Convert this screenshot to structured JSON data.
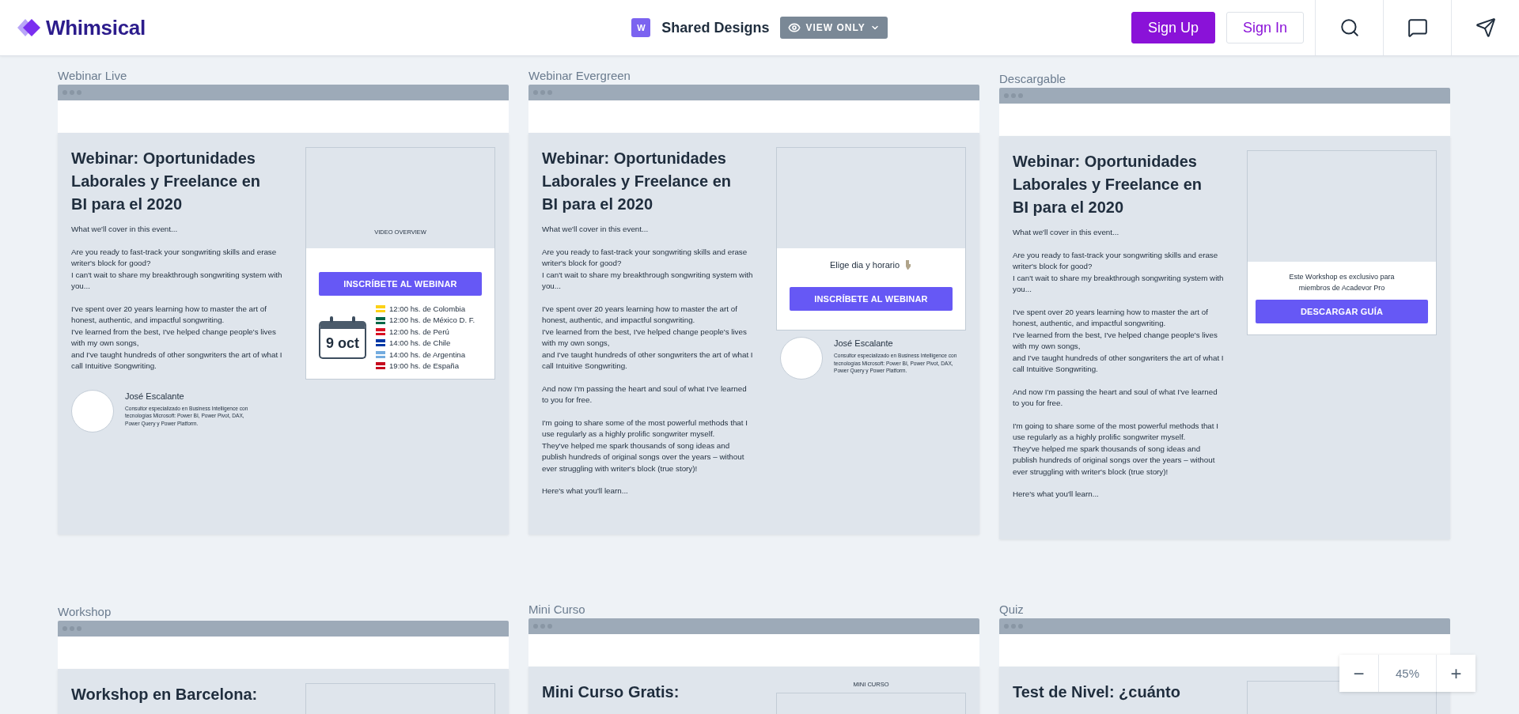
{
  "header": {
    "logo": "Whimsical",
    "board_badge": "W",
    "board_title": "Shared Designs",
    "access": "VIEW ONLY",
    "buttons": [
      {
        "label": "Sign Up",
        "kind": "primary"
      },
      {
        "label": "Sign In",
        "kind": "secondary"
      }
    ]
  },
  "frames": [
    {
      "label": "Webinar Live",
      "kind": "live",
      "title": "Webinar: Oportunidades\nLaborales y Freelance en\nBI para el 2020",
      "paragraphs": [
        "What we'll cover in this event...",
        "Are you ready to fast-track your songwriting skills and erase writer's block for good?\nI can't wait to share my breakthrough songwriting system with you...",
        "I've spent over 20 years learning how to master the art of honest, authentic, and impactful songwriting.\nI've learned from the best, I've helped change people's lives with my own songs,\nand I've taught hundreds of other songwriters the art of what I call Intuitive Songwriting."
      ],
      "card": {
        "media_caption": "VIDEO OVERVIEW",
        "button": "INSCRÍBETE AL WEBINAR",
        "date": "9 oct",
        "schedule": [
          {
            "text": "12:00 hs. de Colombia",
            "color": "#fcd116"
          },
          {
            "text": "12:00 hs. de México D. F.",
            "color": "#006847"
          },
          {
            "text": "12:00 hs. de Perú",
            "color": "#d91023"
          },
          {
            "text": "14:00 hs. de Chile",
            "color": "#0039a6"
          },
          {
            "text": "14:00 hs. de Argentina",
            "color": "#74acdf"
          },
          {
            "text": "19:00 hs. de España",
            "color": "#c60b1e"
          }
        ]
      },
      "author": {
        "name": "José Escalante",
        "bio": "Consultor especializado en Business Intelligence con tecnologías Microsoft: Power BI, Power Pivot, DAX, Power Query y Power Platform."
      }
    },
    {
      "label": "Webinar Evergreen",
      "kind": "evergreen",
      "title": "Webinar: Oportunidades\nLaborales y Freelance en\nBI para el 2020",
      "paragraphs": [
        "What we'll cover in this event...",
        "Are you ready to fast-track your songwriting skills and erase writer's block for good?\nI can't wait to share my breakthrough songwriting system with you...",
        "I've spent over 20 years learning how to master the art of honest, authentic, and impactful songwriting.\nI've learned from the best, I've helped change people's lives with my own songs,\nand I've taught hundreds of other songwriters the art of what I call Intuitive Songwriting.",
        "And now I'm passing the heart and soul of what I've learned to you for free.",
        "I'm going to share some of the most powerful methods that I use regularly as a highly prolific songwriter myself.\nThey've helped me spark thousands of song ideas and publish hundreds of original songs over the years – without ever struggling with writer's block (true story)!",
        "Here's what you'll learn..."
      ],
      "card": {
        "prompt": "Elige dia y horario",
        "button": "INSCRÍBETE AL WEBINAR"
      },
      "author": {
        "name": "José Escalante",
        "bio": "Consultor especializado en Business Intelligence con tecnologías Microsoft: Power BI, Power Pivot, DAX, Power Query y Power Platform."
      }
    },
    {
      "label": "Descargable",
      "kind": "download",
      "title": "Webinar: Oportunidades\nLaborales y Freelance en\nBI para el 2020",
      "paragraphs": [
        "What we'll cover in this event...",
        "Are you ready to fast-track your songwriting skills and erase writer's block for good?\nI can't wait to share my breakthrough songwriting system with you...",
        "I've spent over 20 years learning how to master the art of honest, authentic, and impactful songwriting.\nI've learned from the best, I've helped change people's lives with my own songs,\nand I've taught hundreds of other songwriters the art of what I call Intuitive Songwriting.",
        "And now I'm passing the heart and soul of what I've learned to you for free.",
        "I'm going to share some of the most powerful methods that I use regularly as a highly prolific songwriter myself.\nThey've helped me spark thousands of song ideas and publish hundreds of original songs over the years – without ever struggling with writer's block (true story)!",
        "Here's what you'll learn..."
      ],
      "card": {
        "note": "Este Workshop es exclusivo para\nmiembros de Acadevor Pro",
        "button": "DESCARGAR GUÍA"
      }
    },
    {
      "label": "Workshop",
      "kind": "partial",
      "title": "Workshop en Barcelona:"
    },
    {
      "label": "Mini Curso",
      "kind": "partial",
      "title": "Mini Curso Gratis:",
      "card_caption": "MINI CURSO"
    },
    {
      "label": "Quiz",
      "kind": "partial",
      "title": "Test de Nivel: ¿cuánto"
    }
  ],
  "zoom": {
    "out": "−",
    "value": "45%",
    "in": "+"
  }
}
